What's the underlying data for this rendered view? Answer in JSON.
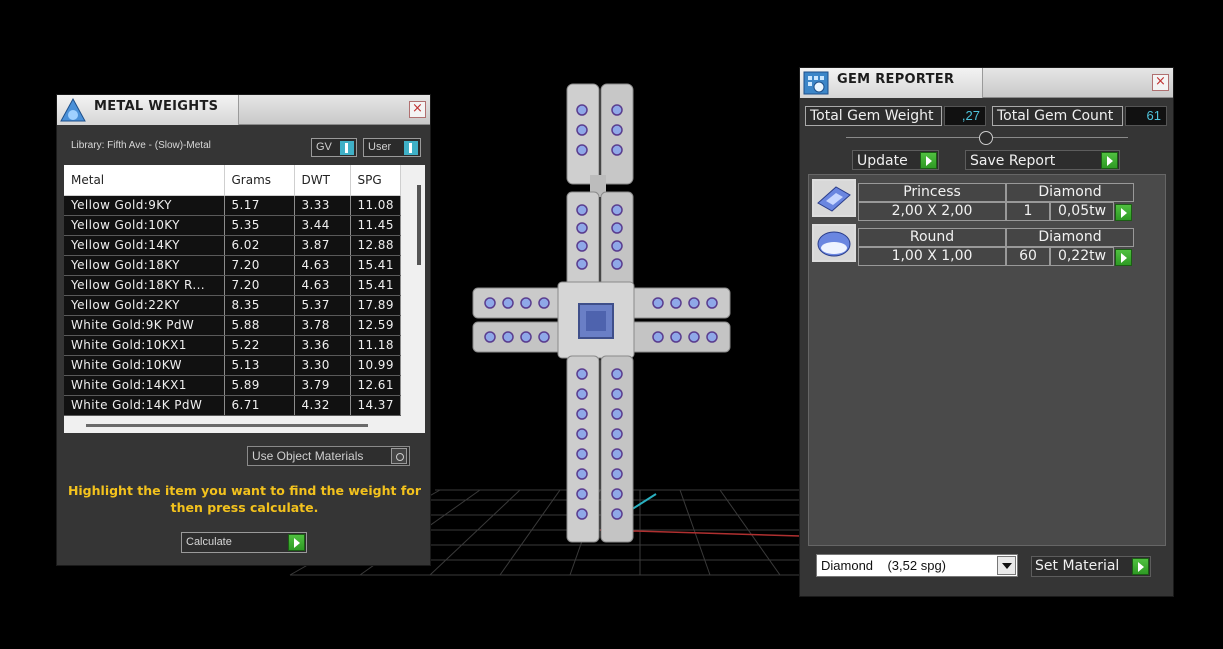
{
  "metal_weights": {
    "title": "METAL WEIGHTS",
    "close_glyph": "×",
    "library": "Library: Fifth Ave - (Slow)-Metal",
    "gv_label": "GV",
    "user_label": "User",
    "columns": [
      "Metal",
      "Grams",
      "DWT",
      "SPG"
    ],
    "rows": [
      [
        "Yellow Gold:9KY",
        "5.17",
        "3.33",
        "11.08"
      ],
      [
        "Yellow Gold:10KY",
        "5.35",
        "3.44",
        "11.45"
      ],
      [
        "Yellow Gold:14KY",
        "6.02",
        "3.87",
        "12.88"
      ],
      [
        "Yellow Gold:18KY",
        "7.20",
        "4.63",
        "15.41"
      ],
      [
        "Yellow Gold:18KY R...",
        "7.20",
        "4.63",
        "15.41"
      ],
      [
        "Yellow Gold:22KY",
        "8.35",
        "5.37",
        "17.89"
      ],
      [
        "White Gold:9K PdW",
        "5.88",
        "3.78",
        "12.59"
      ],
      [
        "White Gold:10KX1",
        "5.22",
        "3.36",
        "11.18"
      ],
      [
        "White Gold:10KW",
        "5.13",
        "3.30",
        "10.99"
      ],
      [
        "White Gold:14KX1",
        "5.89",
        "3.79",
        "12.61"
      ],
      [
        "White Gold:14K PdW",
        "6.71",
        "4.32",
        "14.37"
      ]
    ],
    "use_object_materials": "Use Object Materials",
    "hint": "Highlight the item you want to find the weight for then press calculate.",
    "calculate_label": "Calculate"
  },
  "gem_reporter": {
    "title": "GEM REPORTER",
    "close_glyph": "×",
    "total_weight_label": "Total Gem Weight",
    "total_weight_value": ",27",
    "total_count_label": "Total Gem Count",
    "total_count_value": "61",
    "update_label": "Update",
    "save_report_label": "Save Report",
    "gems": [
      {
        "cut": "Princess",
        "material": "Diamond",
        "size": "2,00 X 2,00",
        "count": "1",
        "weight": "0,05tw"
      },
      {
        "cut": "Round",
        "material": "Diamond",
        "size": "1,00 X 1,00",
        "count": "60",
        "weight": "0,22tw"
      }
    ],
    "material_select": "Diamond    (3,52 spg)",
    "set_material_label": "Set Material"
  },
  "colors": {
    "hint_yellow": "#f3c21d",
    "value_cyan": "#4fc4dc",
    "go_green": "#3fae30",
    "gem_blue": "#8fa8e8"
  }
}
